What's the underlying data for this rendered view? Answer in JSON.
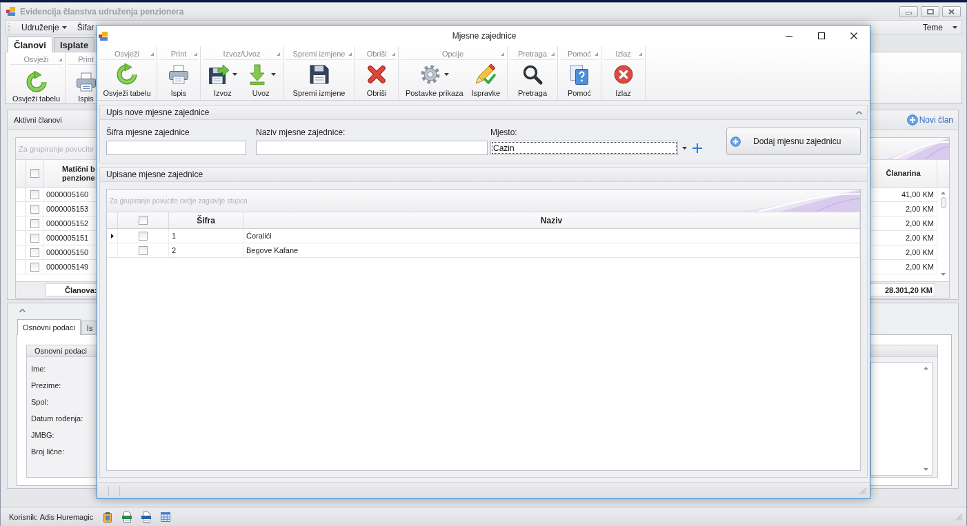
{
  "main_window": {
    "title": "Evidencija članstva udruženja penzionera",
    "menu": [
      {
        "label": "Udruženje",
        "dropdown": true
      },
      {
        "label": "Šifar"
      }
    ],
    "theme_menu": {
      "label": "Teme",
      "dropdown": true
    },
    "tabs": [
      {
        "label": "Članovi",
        "selected": true
      },
      {
        "label": "Isplate",
        "selected": false
      }
    ],
    "ribbon": [
      {
        "caption": "Osvježi",
        "buttons": [
          {
            "label": "Osvježi tabelu",
            "dropdown": false
          }
        ]
      },
      {
        "caption": "Print",
        "buttons": [
          {
            "label": "Ispis",
            "dropdown": false
          }
        ]
      }
    ],
    "members": {
      "title": "Aktivni članovi",
      "new_link": "Novi član",
      "group_hint": "Za grupiranje povucite",
      "header_checked": false,
      "columns": [
        {
          "lines": [
            "Matični b",
            "penzione"
          ]
        },
        {
          "lines": [
            "Članarina"
          ]
        }
      ],
      "rows": [
        {
          "checked": false,
          "cells": [
            "0000005160",
            "41,00 KM"
          ]
        },
        {
          "checked": false,
          "cells": [
            "0000005153",
            "2,00 KM"
          ]
        },
        {
          "checked": false,
          "cells": [
            "0000005152",
            "2,00 KM"
          ]
        },
        {
          "checked": false,
          "cells": [
            "0000005151",
            "2,00 KM"
          ]
        },
        {
          "checked": false,
          "cells": [
            "0000005150",
            "2,00 KM"
          ]
        },
        {
          "checked": false,
          "cells": [
            "0000005149",
            "2,00 KM"
          ]
        }
      ],
      "footer": {
        "label": "Članova:",
        "total": "28.301,20 KM"
      }
    },
    "details": {
      "expanded": true,
      "tabs": [
        {
          "label": "Osnovni podaci",
          "selected": true
        },
        {
          "label": "Is",
          "selected": false
        }
      ],
      "group_title": "Osnovni podaci",
      "fields": [
        "Ime:",
        "Prezime:",
        "Spol:",
        "Datum rođenja:",
        "JMBG:",
        "Broj lične:"
      ]
    },
    "status_bar": {
      "user": "Korisnik: Adis Huremagic"
    }
  },
  "dialog": {
    "title": "Mjesne zajednice",
    "ribbon": [
      {
        "caption": "Osvježi",
        "buttons": [
          {
            "label": "Osvježi tabelu",
            "dropdown": false
          }
        ]
      },
      {
        "caption": "Print",
        "buttons": [
          {
            "label": "Ispis",
            "dropdown": false
          }
        ]
      },
      {
        "caption": "Izvoz/Uvoz",
        "buttons": [
          {
            "label": "Izvoz",
            "dropdown": true
          },
          {
            "label": "Uvoz",
            "dropdown": true
          }
        ]
      },
      {
        "caption": "Spremi izmjene",
        "buttons": [
          {
            "label": "Spremi izmjene",
            "dropdown": false
          }
        ]
      },
      {
        "caption": "Obriši",
        "buttons": [
          {
            "label": "Obriši",
            "dropdown": false
          }
        ]
      },
      {
        "caption": "Opcije",
        "buttons": [
          {
            "label": "Postavke prikaza",
            "dropdown": true
          },
          {
            "label": "Ispravke",
            "dropdown": false
          }
        ]
      },
      {
        "caption": "Pretraga",
        "buttons": [
          {
            "label": "Pretraga",
            "dropdown": false
          }
        ]
      },
      {
        "caption": "Pomoć",
        "buttons": [
          {
            "label": "Pomoć",
            "dropdown": false
          }
        ]
      },
      {
        "caption": "Izlaz",
        "buttons": [
          {
            "label": "Izlaz",
            "dropdown": false
          }
        ]
      }
    ],
    "entry_panel": {
      "title": "Upis nove mjesne zajednice",
      "expanded": true,
      "fields": [
        {
          "kind": "text",
          "label": "Šifra mjesne zajednice"
        },
        {
          "kind": "text",
          "label": "Naziv mjesne zajednice:"
        },
        {
          "kind": "combo",
          "label": "Mjesto:",
          "value": "Cazin",
          "focused": true
        }
      ],
      "add_button": "Dodaj mjesnu zajednicu"
    },
    "list_panel": {
      "title": "Upisane mjesne zajednice",
      "group_hint": "Za grupiranje povucite ovdje zaglavlje stupca",
      "header_checked": false,
      "columns": [
        "Šifra",
        "Naziv"
      ],
      "rows": [
        {
          "current": true,
          "checked": false,
          "cells": [
            "1",
            "Ćoralići"
          ]
        },
        {
          "current": false,
          "checked": false,
          "cells": [
            "2",
            "Begove Kafane"
          ]
        }
      ]
    }
  }
}
